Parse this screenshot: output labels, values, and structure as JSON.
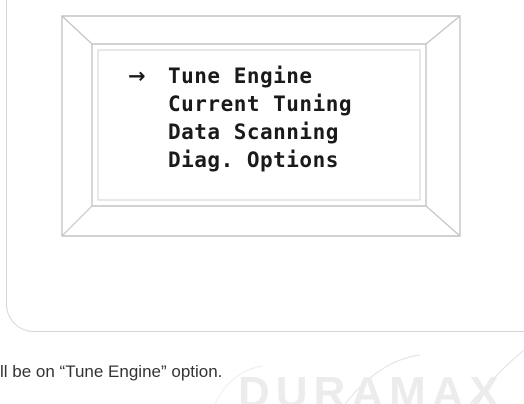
{
  "menu": {
    "cursor_icon": "arrow-right-icon",
    "cursor_glyph": "→",
    "items": [
      {
        "label": "Tune Engine",
        "selected": true
      },
      {
        "label": "Current Tuning",
        "selected": false
      },
      {
        "label": "Data Scanning",
        "selected": false
      },
      {
        "label": "Diag. Options",
        "selected": false
      }
    ]
  },
  "caption": {
    "text": "ll be on “Tune Engine” option."
  },
  "watermark": {
    "text": "DURAMAX"
  },
  "colors": {
    "screen_text": "#1a1a1a",
    "frame_line": "#c8c8c8",
    "device_outline": "#d6d6d6",
    "watermark": "#ececec"
  }
}
